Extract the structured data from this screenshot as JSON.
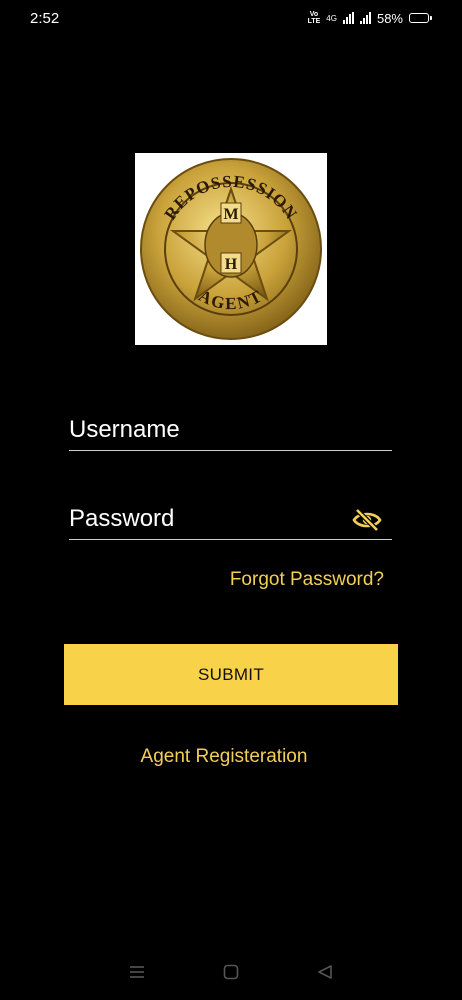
{
  "status_bar": {
    "time": "2:52",
    "volte_top": "Vo",
    "volte_bottom": "LTE",
    "network": "4G",
    "battery_percent": "58%",
    "battery_level": 0.58
  },
  "logo": {
    "top_text": "REPOSSESSION",
    "bottom_text": "AGENT",
    "monogram_top": "M",
    "monogram_bottom": "H",
    "badge_gold": "#c9a23a",
    "background": "#ffffff"
  },
  "login_form": {
    "username": {
      "placeholder": "Username",
      "value": ""
    },
    "password": {
      "placeholder": "Password",
      "value": ""
    },
    "visibility_icon": "eye-off-icon",
    "forgot_password_label": "Forgot Password?",
    "submit_label": "SUBMIT",
    "register_label": "Agent Registeration"
  },
  "colors": {
    "background": "#000000",
    "accent": "#f8d34a",
    "link": "#f3cf58",
    "underline": "#cfcfcf"
  },
  "nav_bar": {
    "recents_icon": "menu-icon",
    "home_icon": "square-icon",
    "back_icon": "triangle-back-icon"
  }
}
